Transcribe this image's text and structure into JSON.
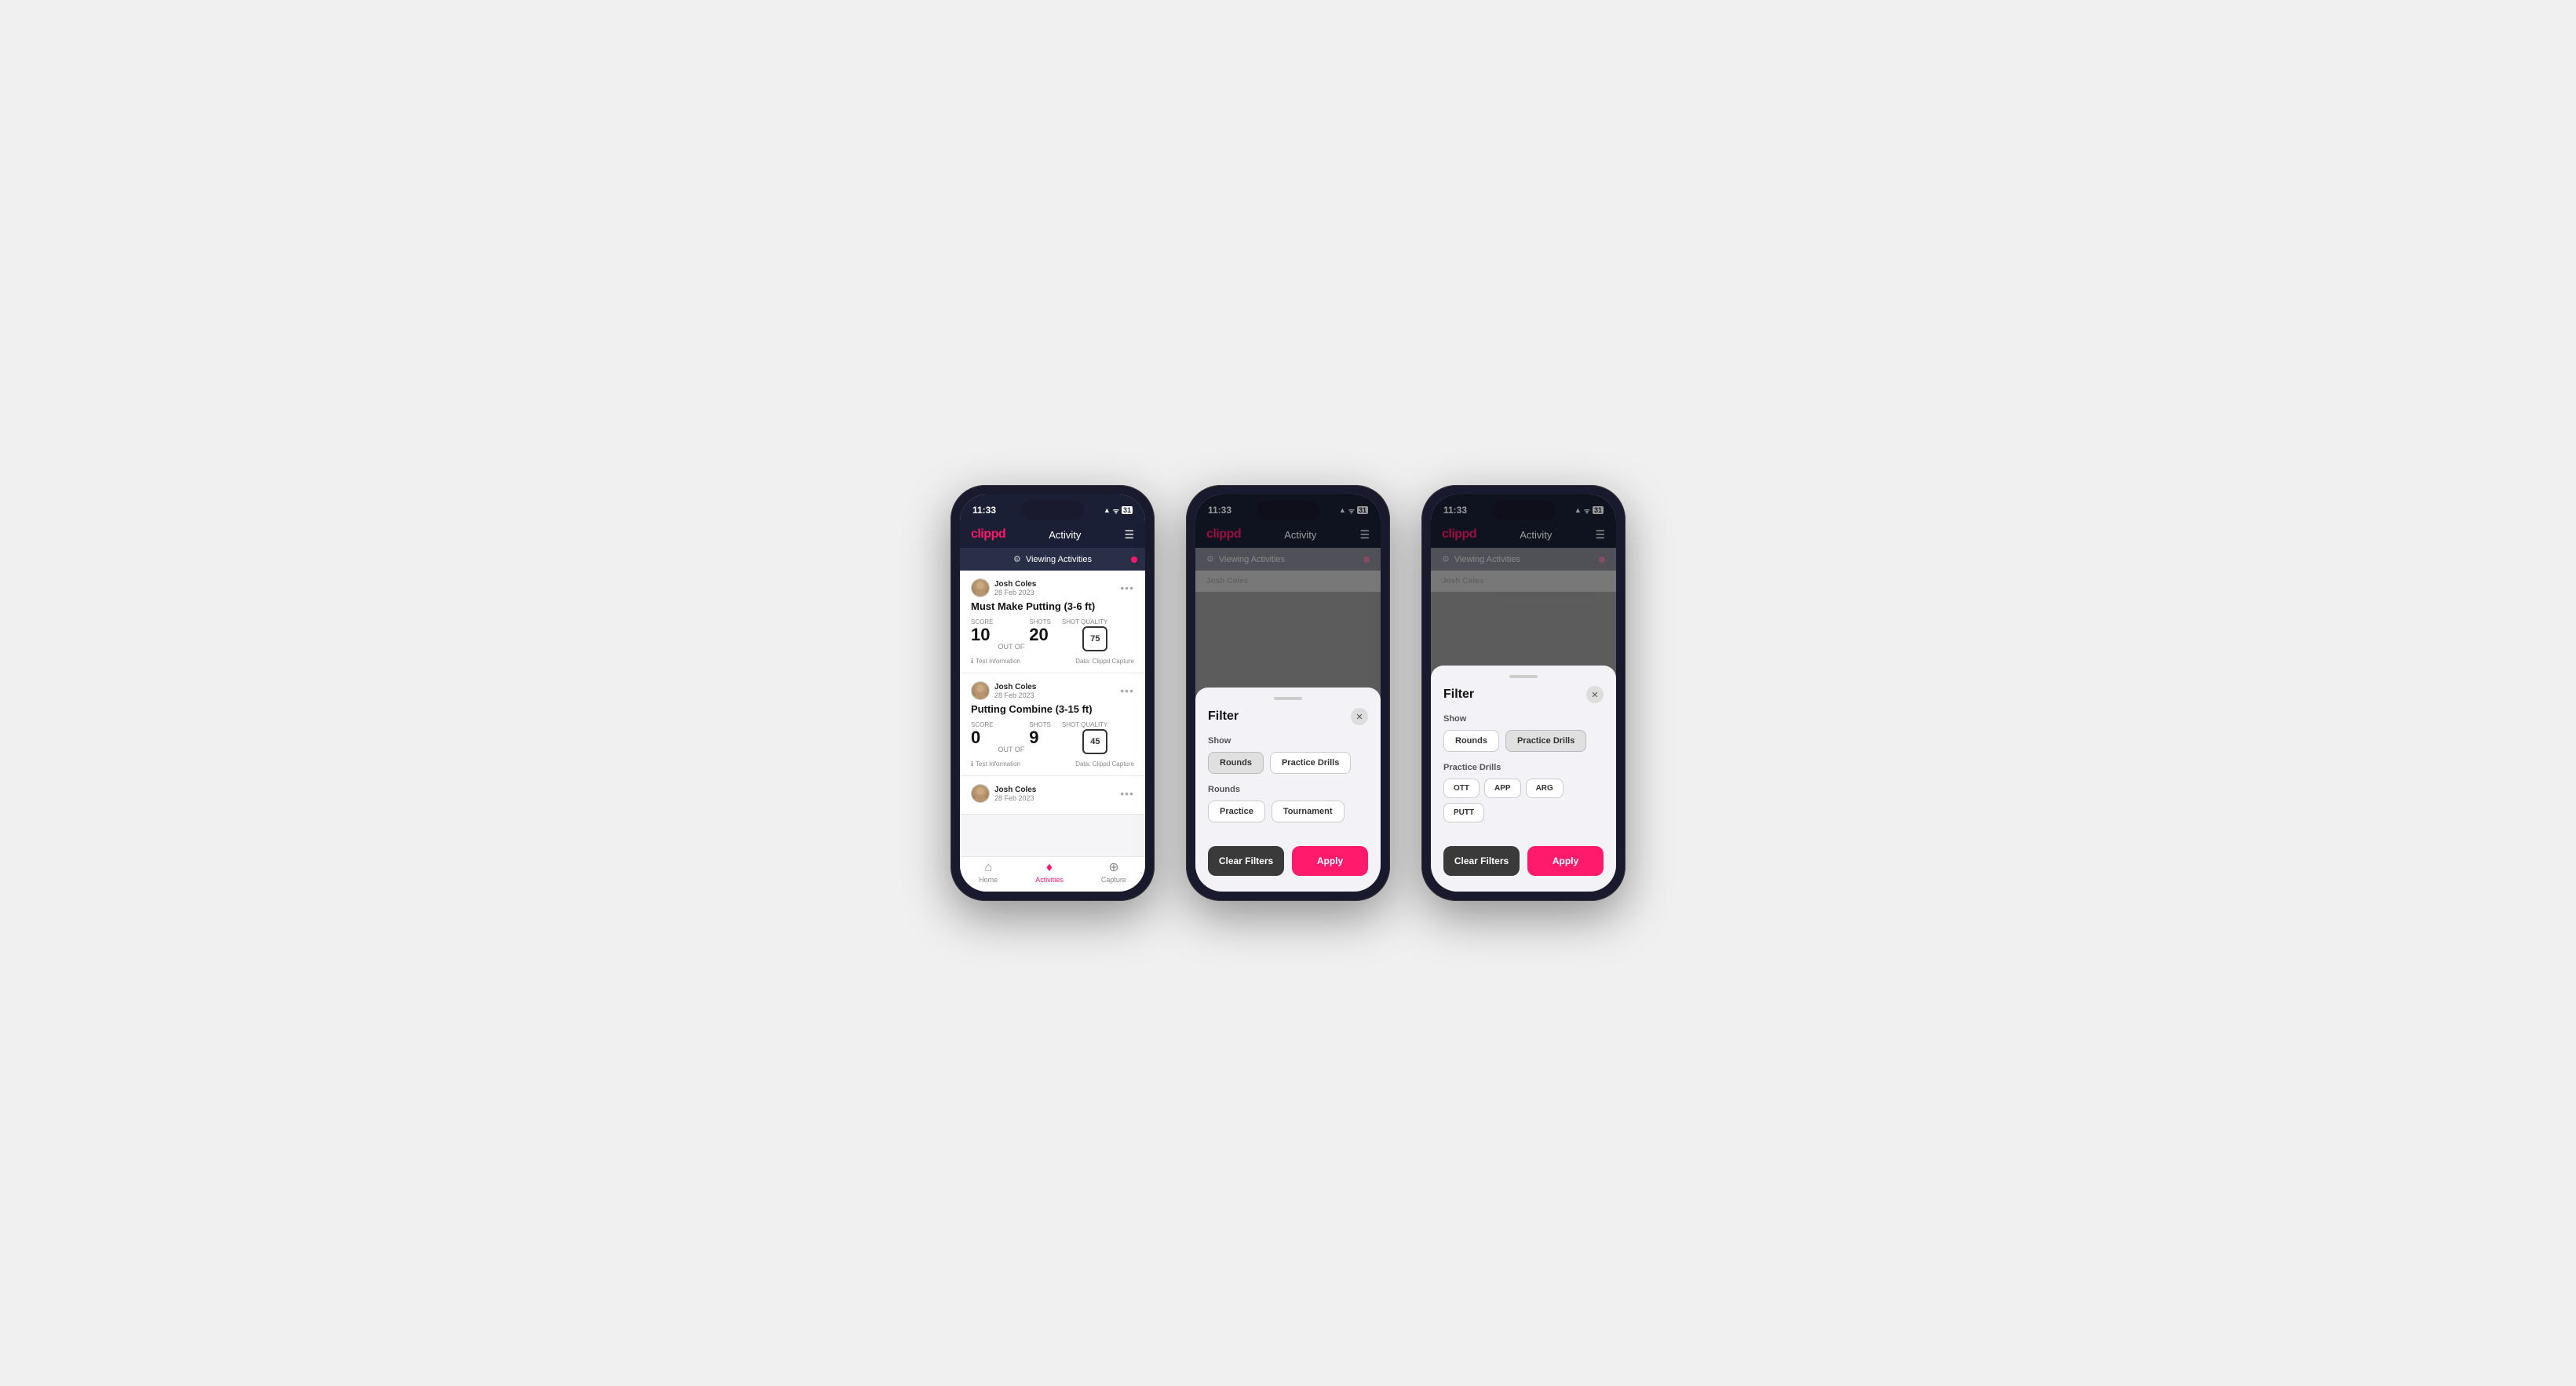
{
  "app": {
    "logo": "clippd",
    "nav_title": "Activity",
    "time": "11:33",
    "status_icons": "▲ ᯤ 🔋"
  },
  "banner": {
    "text": "Viewing Activities",
    "icon": "⚙"
  },
  "screen1": {
    "cards": [
      {
        "user_name": "Josh Coles",
        "user_date": "28 Feb 2023",
        "title": "Must Make Putting (3-6 ft)",
        "score_label": "Score",
        "score": "10",
        "out_of": "OUT OF",
        "shots_label": "Shots",
        "shots": "20",
        "shot_quality_label": "Shot Quality",
        "shot_quality": "75",
        "test_info": "Test Information",
        "data_source": "Data: Clippd Capture"
      },
      {
        "user_name": "Josh Coles",
        "user_date": "28 Feb 2023",
        "title": "Putting Combine (3-15 ft)",
        "score_label": "Score",
        "score": "0",
        "out_of": "OUT OF",
        "shots_label": "Shots",
        "shots": "9",
        "shot_quality_label": "Shot Quality",
        "shot_quality": "45",
        "test_info": "Test Information",
        "data_source": "Data: Clippd Capture"
      },
      {
        "user_name": "Josh Coles",
        "user_date": "28 Feb 2023",
        "title": "",
        "score_label": "",
        "score": "",
        "shot_quality": "",
        "test_info": "",
        "data_source": ""
      }
    ],
    "bottom_nav": [
      {
        "label": "Home",
        "icon": "⌂",
        "active": false
      },
      {
        "label": "Activities",
        "icon": "♦",
        "active": true
      },
      {
        "label": "Capture",
        "icon": "⊕",
        "active": false
      }
    ]
  },
  "filter_screen2": {
    "title": "Filter",
    "show_label": "Show",
    "show_buttons": [
      {
        "label": "Rounds",
        "active": true
      },
      {
        "label": "Practice Drills",
        "active": false
      }
    ],
    "rounds_label": "Rounds",
    "rounds_buttons": [
      {
        "label": "Practice",
        "active": false
      },
      {
        "label": "Tournament",
        "active": false
      }
    ],
    "clear_filters": "Clear Filters",
    "apply": "Apply"
  },
  "filter_screen3": {
    "title": "Filter",
    "show_label": "Show",
    "show_buttons": [
      {
        "label": "Rounds",
        "active": false
      },
      {
        "label": "Practice Drills",
        "active": true
      }
    ],
    "practice_drills_label": "Practice Drills",
    "drill_buttons": [
      {
        "label": "OTT",
        "active": false
      },
      {
        "label": "APP",
        "active": false
      },
      {
        "label": "ARG",
        "active": false
      },
      {
        "label": "PUTT",
        "active": false
      }
    ],
    "clear_filters": "Clear Filters",
    "apply": "Apply"
  }
}
